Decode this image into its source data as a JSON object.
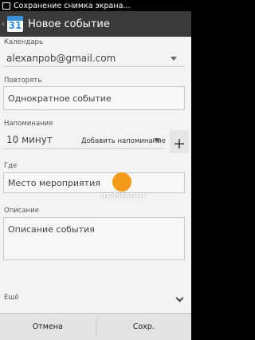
{
  "status_bar": {
    "text": "Сохранение снимка экрана..."
  },
  "action_bar": {
    "calendar_icon_number": "31",
    "title": "Новое событие"
  },
  "form": {
    "calendar": {
      "label": "Календарь",
      "value": "alexanpob@gmail.com"
    },
    "repeat": {
      "label": "Повторять",
      "value": "Однократное событие"
    },
    "reminders": {
      "label": "Напоминания",
      "value": "10 минут",
      "add_label": "Добавить напоминание"
    },
    "where": {
      "label": "Где",
      "placeholder": "Место мероприятия"
    },
    "description": {
      "label": "Описание",
      "placeholder": "Описание события"
    },
    "more": {
      "label": "Ещё"
    }
  },
  "watermark": {
    "text": "mobiset.ru"
  },
  "bottom_bar": {
    "cancel_label": "Отмена",
    "save_label": "Сохр."
  },
  "colors": {
    "action_bar": "#3a3a3a",
    "content_bg": "#f3f3f3",
    "bottom_bar": "#e3e3e3",
    "accent": "#3a8fd6",
    "watermark": "#f39a1d"
  }
}
